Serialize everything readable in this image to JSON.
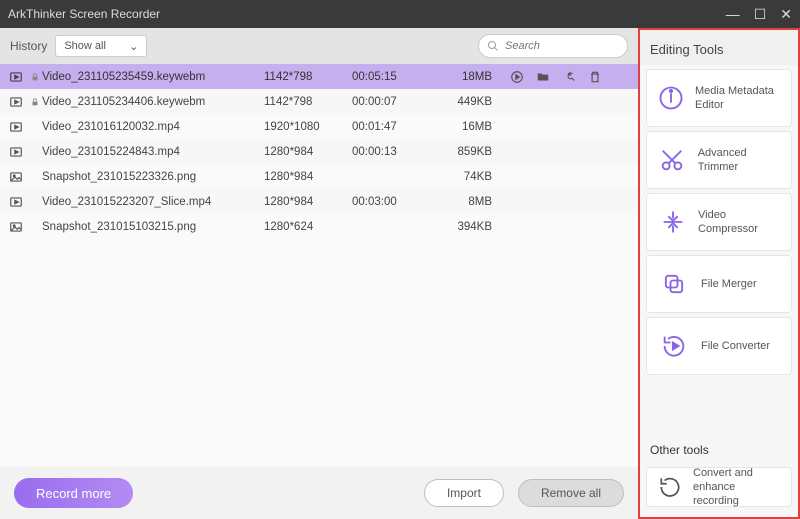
{
  "app_title": "ArkThinker Screen Recorder",
  "history_label": "History",
  "filter": {
    "selected": "Show all"
  },
  "search": {
    "placeholder": "Search"
  },
  "files": [
    {
      "type": "video",
      "locked": true,
      "name": "Video_231105235459.keywebm",
      "res": "1142*798",
      "dur": "00:05:15",
      "size": "18MB",
      "selected": true
    },
    {
      "type": "video",
      "locked": true,
      "name": "Video_231105234406.keywebm",
      "res": "1142*798",
      "dur": "00:00:07",
      "size": "449KB",
      "selected": false
    },
    {
      "type": "video",
      "locked": false,
      "name": "Video_231016120032.mp4",
      "res": "1920*1080",
      "dur": "00:01:47",
      "size": "16MB",
      "selected": false
    },
    {
      "type": "video",
      "locked": false,
      "name": "Video_231015224843.mp4",
      "res": "1280*984",
      "dur": "00:00:13",
      "size": "859KB",
      "selected": false
    },
    {
      "type": "image",
      "locked": false,
      "name": "Snapshot_231015223326.png",
      "res": "1280*984",
      "dur": "",
      "size": "74KB",
      "selected": false
    },
    {
      "type": "video",
      "locked": false,
      "name": "Video_231015223207_Slice.mp4",
      "res": "1280*984",
      "dur": "00:03:00",
      "size": "8MB",
      "selected": false
    },
    {
      "type": "image",
      "locked": false,
      "name": "Snapshot_231015103215.png",
      "res": "1280*624",
      "dur": "",
      "size": "394KB",
      "selected": false
    }
  ],
  "buttons": {
    "record": "Record more",
    "import": "Import",
    "remove_all": "Remove all"
  },
  "right": {
    "title": "Editing Tools",
    "tools": [
      {
        "label": "Media Metadata Editor"
      },
      {
        "label": "Advanced Trimmer"
      },
      {
        "label": "Video Compressor"
      },
      {
        "label": "File Merger"
      },
      {
        "label": "File Converter"
      }
    ],
    "other_title": "Other tools",
    "other": [
      {
        "label": "Convert and enhance recording"
      }
    ]
  }
}
